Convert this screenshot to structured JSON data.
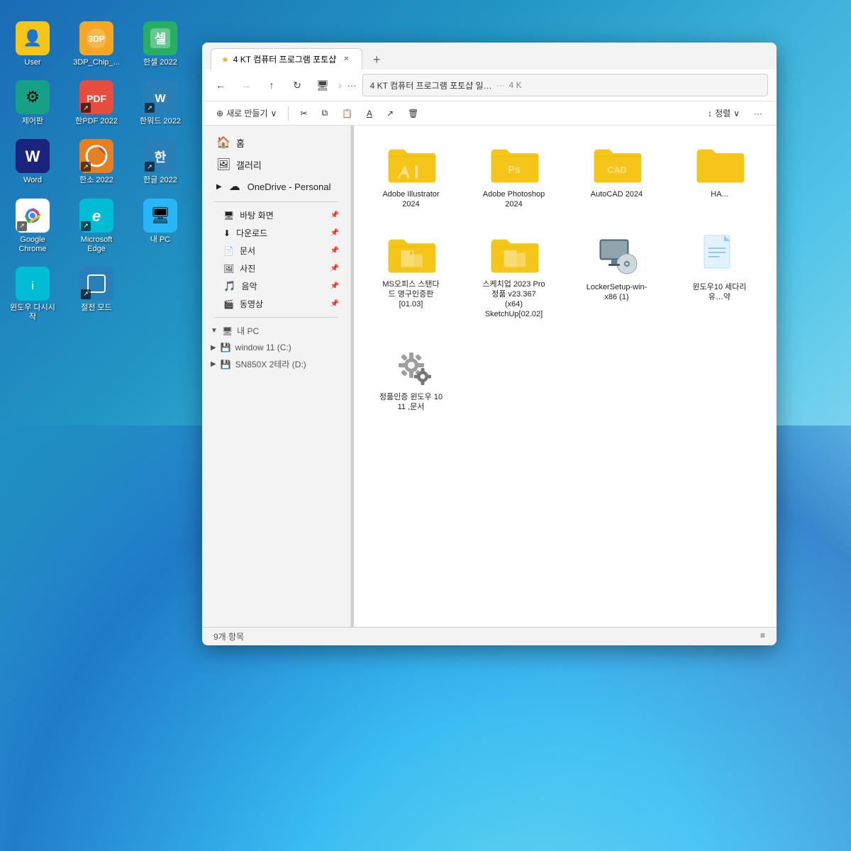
{
  "desktop": {
    "background": "windows11-wallpaper"
  },
  "desktop_icons": {
    "rows": [
      [
        {
          "id": "user",
          "label": "User",
          "icon": "👤",
          "color": "icon-yellow",
          "shortcut": false
        },
        {
          "id": "3dp-chip",
          "label": "3DP_Chip_...",
          "icon": "🔧",
          "color": "icon-orange",
          "shortcut": false
        },
        {
          "id": "hancom-2022",
          "label": "한셀 2022",
          "icon": "📊",
          "color": "icon-green",
          "shortcut": false
        }
      ],
      [
        {
          "id": "jepan",
          "label": "제어판",
          "icon": "⚙",
          "color": "icon-teal",
          "shortcut": false
        },
        {
          "id": "hanpdf",
          "label": "한PDF 2022",
          "icon": "📄",
          "color": "icon-red",
          "shortcut": true
        },
        {
          "id": "hanword",
          "label": "한워드 2022",
          "icon": "✏",
          "color": "icon-blue",
          "shortcut": true
        }
      ],
      [
        {
          "id": "word",
          "label": "Word",
          "icon": "W",
          "color": "icon-dark-blue",
          "shortcut": false
        },
        {
          "id": "hanso",
          "label": "한소 2022",
          "icon": "◐",
          "color": "icon-orange",
          "shortcut": true
        },
        {
          "id": "hangul",
          "label": "한글 2022",
          "icon": "한",
          "color": "icon-blue",
          "shortcut": true
        }
      ],
      [
        {
          "id": "chrome",
          "label": "Google Chrome",
          "icon": "◎",
          "color": "icon-white",
          "shortcut": true
        },
        {
          "id": "edge",
          "label": "Microsoft Edge",
          "icon": "e",
          "color": "icon-cyan",
          "shortcut": true
        },
        {
          "id": "mypc",
          "label": "내 PC",
          "icon": "🖥",
          "color": "icon-light-blue",
          "shortcut": false
        }
      ],
      [
        {
          "id": "windrestart",
          "label": "윈도우 다시시작",
          "icon": "i",
          "color": "icon-cyan",
          "shortcut": false
        },
        {
          "id": "sleep",
          "label": "절전 모드",
          "icon": "⊡",
          "color": "icon-blue",
          "shortcut": true
        }
      ]
    ]
  },
  "file_explorer": {
    "title_bar": {
      "tab_label": "4 KT 컴퓨터 프로그램 포토샵",
      "tab_add_label": "+"
    },
    "nav_bar": {
      "back_label": "←",
      "forward_label": "→",
      "up_label": "↑",
      "refresh_label": "↻",
      "address_parts": [
        "4 KT 컴퓨터 프로그램 포토샵 일…",
        "4 K"
      ],
      "separator": "›",
      "more_label": "···"
    },
    "toolbar": {
      "new_label": "⊕ 새로 만들기 ∨",
      "cut_icon": "✂",
      "copy_icon": "⧉",
      "paste_icon": "📋",
      "rename_icon": "A̲",
      "share_icon": "↗",
      "delete_icon": "🗑",
      "sort_label": "↕ 정렬 ∨",
      "more_label": "···"
    },
    "sidebar": {
      "items": [
        {
          "id": "home",
          "label": "홈",
          "icon": "🏠"
        },
        {
          "id": "gallery",
          "label": "갤러리",
          "icon": "🖼"
        },
        {
          "id": "onedrive",
          "label": "OneDrive - Personal",
          "icon": "☁",
          "expandable": true
        }
      ],
      "quick_access": [
        {
          "id": "desktop",
          "label": "바탕 화면",
          "icon": "🖥",
          "pinned": true
        },
        {
          "id": "downloads",
          "label": "다운로드",
          "icon": "⬇",
          "pinned": true
        },
        {
          "id": "documents",
          "label": "문서",
          "icon": "📄",
          "pinned": true
        },
        {
          "id": "pictures",
          "label": "사진",
          "icon": "🖼",
          "pinned": true
        },
        {
          "id": "music",
          "label": "음악",
          "icon": "🎵",
          "pinned": true
        },
        {
          "id": "videos",
          "label": "동영상",
          "icon": "🎬",
          "pinned": true
        }
      ],
      "drives": [
        {
          "id": "mypc-nav",
          "label": "내 PC",
          "icon": "🖥",
          "expandable": true,
          "expanded": true
        },
        {
          "id": "win-c",
          "label": "window 11 (C:)",
          "icon": "💾",
          "expandable": true
        },
        {
          "id": "sn850x",
          "label": "SN850X 2테라 (D:)",
          "icon": "💾",
          "expandable": true
        }
      ]
    },
    "files": [
      {
        "id": "adobe-illustrator",
        "type": "folder",
        "name": "Adobe Illustrator 2024"
      },
      {
        "id": "adobe-photoshop",
        "type": "folder",
        "name": "Adobe Photoshop 2024"
      },
      {
        "id": "autocad",
        "type": "folder",
        "name": "AutoCAD 2024"
      },
      {
        "id": "ha-folder",
        "type": "folder",
        "name": "HA..."
      },
      {
        "id": "msoffice",
        "type": "folder",
        "name": "MS오피스 스탠다드 영구인증판 [01.03]"
      },
      {
        "id": "sketchup",
        "type": "folder",
        "name": "스케치업 2023 Pro 정품 v23.367 (x64) SketchUp[02.02]"
      },
      {
        "id": "locker-setup",
        "type": "app",
        "name": "LockerSetup-win-x86 (1)"
      },
      {
        "id": "windows-doc",
        "type": "document",
        "name": "윈도우10 세다리 유…약"
      },
      {
        "id": "genuine-windows",
        "type": "settings",
        "name": "정품인증 윈도우 10 11 ,문서"
      }
    ],
    "status_bar": {
      "count": "9개 항목"
    }
  }
}
